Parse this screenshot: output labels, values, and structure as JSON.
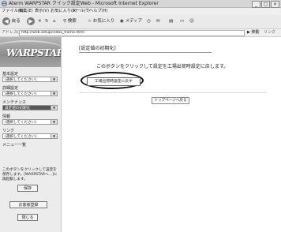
{
  "window": {
    "title": "Aterm WARPSTAR クイック設定Web - Microsoft Internet Explorer",
    "controls": [
      "_",
      "□",
      "×"
    ]
  },
  "menu": {
    "items": [
      "ファイル(F)",
      "編集(E)",
      "表示(V)",
      "お気に入り(A)",
      "ツール(T)",
      "ヘルプ(H)"
    ]
  },
  "toolbar": {
    "back": "戻る",
    "search": "検索",
    "favorites": "お気に入り",
    "media": "メディア"
  },
  "address": {
    "label": "アドレス(D)",
    "url": "http://web.setup/index_frame.html",
    "go": "移動",
    "links": "リンク"
  },
  "sidebar": {
    "logo_text": "WARPSTAR",
    "sections": [
      {
        "title": "基本設定",
        "selected": "(選択してください)"
      },
      {
        "title": "詳細設定",
        "selected": "(選択してください)"
      },
      {
        "title": "メンテナンス",
        "selected": "設定値の初期化"
      },
      {
        "title": "情報",
        "selected": "(選択してください)"
      },
      {
        "title": "リンク",
        "selected": "(選択してください)"
      }
    ],
    "menu_link": "メニュー一覧",
    "save_note": "このボタンをクリックして設定を保存します。[WARPSTARへ…]に再起動します。",
    "save_button": "保存",
    "help_button": "お客様登録",
    "close_button": "閉じる"
  },
  "main": {
    "heading": "[設定値の初期化]",
    "message": "このボタンをクリックして設定を工場出荷時設定に戻します。",
    "reset_button": "工場出荷時設定に戻す",
    "top_button": "トップページへ戻る"
  }
}
